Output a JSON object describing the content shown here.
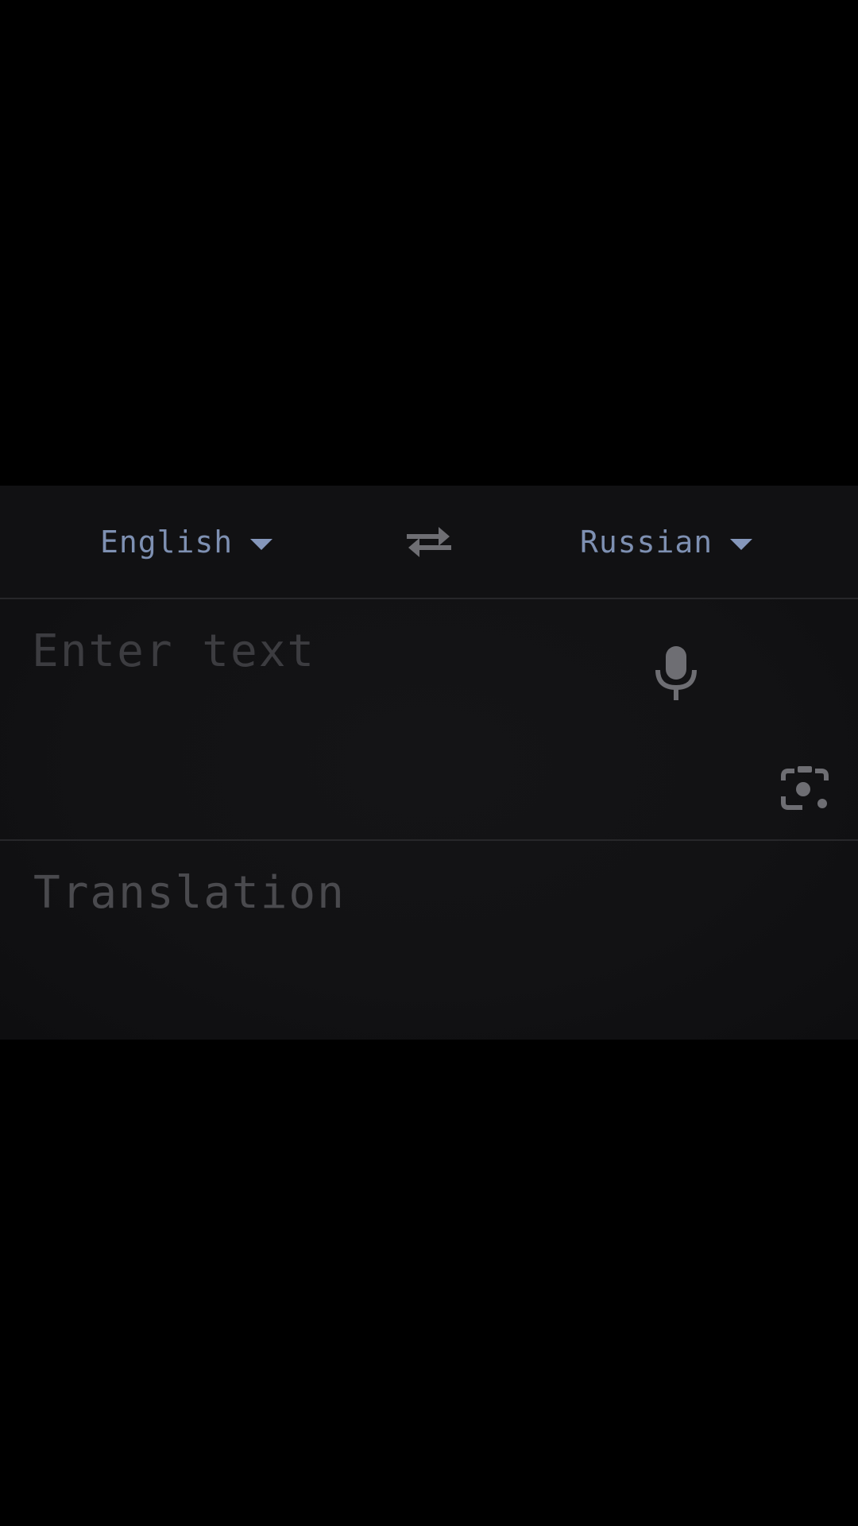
{
  "language_bar": {
    "source_language": "English",
    "target_language": "Russian",
    "swap_icon": "swap-arrows-icon",
    "dropdown_icon": "caret-down-icon"
  },
  "input": {
    "placeholder": "Enter text",
    "value": "",
    "mic_icon": "microphone-icon",
    "camera_icon": "camera-lens-icon"
  },
  "output": {
    "placeholder": "Translation"
  },
  "colors": {
    "background": "#000000",
    "panel": "#121214",
    "language_label": "#7e90b2",
    "caret": "#8597bb",
    "icon": "#6e6e73",
    "placeholder_input": "#3c3c40",
    "placeholder_output": "#4a4a4e",
    "divider": "#27272a"
  }
}
